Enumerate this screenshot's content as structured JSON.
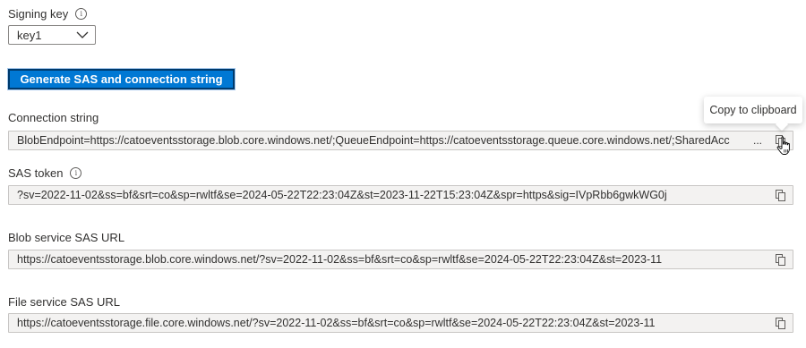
{
  "signing_key": {
    "label": "Signing key",
    "info_icon": "info-icon",
    "selected": "key1"
  },
  "generate_button": {
    "label": "Generate SAS and connection string"
  },
  "connection_string": {
    "label": "Connection string",
    "value": "BlobEndpoint=https://catoeventsstorage.blob.core.windows.net/;QueueEndpoint=https://catoeventsstorage.queue.core.windows.net/;SharedAcc",
    "ellipsis": "...",
    "copy_icon": "copy-icon"
  },
  "tooltip": {
    "text": "Copy to clipboard"
  },
  "sas_token": {
    "label": "SAS token",
    "info_icon": "info-icon",
    "value": "?sv=2022-11-02&ss=bf&srt=co&sp=rwltf&se=2024-05-22T22:23:04Z&st=2023-11-22T15:23:04Z&spr=https&sig=IVpRbb6gwkWG0j",
    "copy_icon": "copy-icon"
  },
  "blob_sas_url": {
    "label": "Blob service SAS URL",
    "value": "https://catoeventsstorage.blob.core.windows.net/?sv=2022-11-02&ss=bf&srt=co&sp=rwltf&se=2024-05-22T22:23:04Z&st=2023-11",
    "copy_icon": "copy-icon"
  },
  "file_sas_url": {
    "label": "File service SAS URL",
    "value": "https://catoeventsstorage.file.core.windows.net/?sv=2022-11-02&ss=bf&srt=co&sp=rwltf&se=2024-05-22T22:23:04Z&st=2023-11",
    "copy_icon": "copy-icon"
  },
  "colors": {
    "primary": "#0078d4",
    "field_bg": "#f3f2f1",
    "field_border": "#c8c6c4",
    "text": "#323130"
  }
}
